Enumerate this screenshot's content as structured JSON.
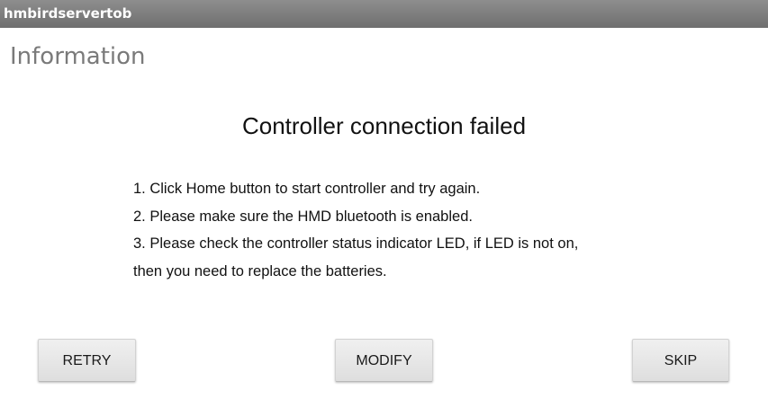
{
  "window": {
    "title": "hmbirdservertob"
  },
  "header": {
    "title": "Information"
  },
  "dialog": {
    "title": "Controller connection failed",
    "instructions": [
      "1. Click Home button to start controller and try again.",
      "2. Please make sure the HMD bluetooth is enabled.",
      "3. Please check the controller status indicator LED, if LED is not on,",
      "then you need to replace the batteries."
    ]
  },
  "buttons": {
    "retry_label": "RETRY",
    "modify_label": "MODIFY",
    "skip_label": "SKIP"
  },
  "colors": {
    "title_bar": "#7f7f7f",
    "heading_text": "#7a7a7a",
    "body_text": "#111111",
    "button_bg": "#e6e6e6"
  }
}
